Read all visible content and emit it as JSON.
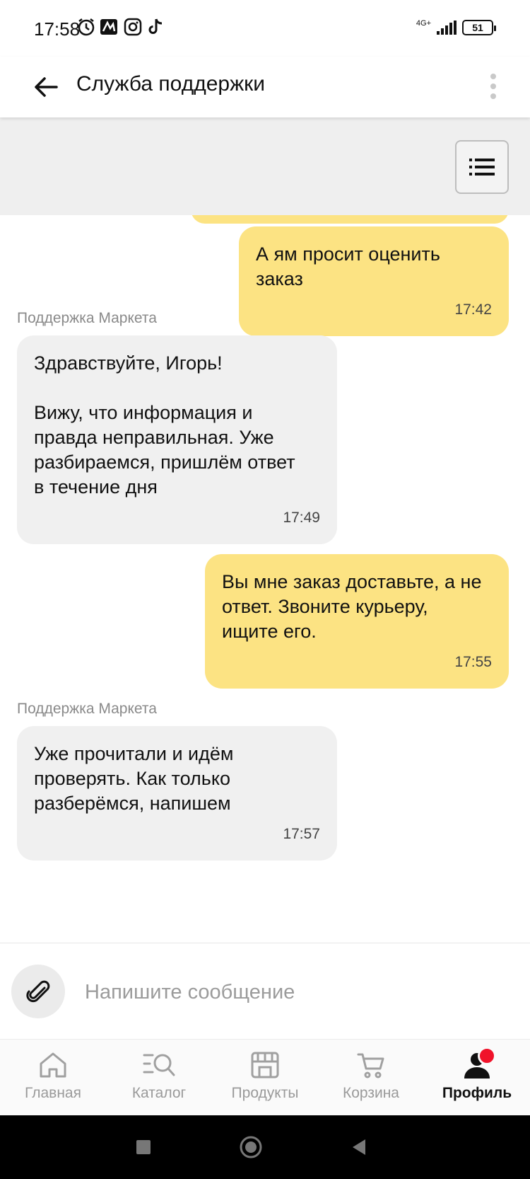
{
  "status_bar": {
    "time": "17:58",
    "icons": [
      "alarm-icon",
      "app-notification-icon",
      "instagram-icon",
      "tiktok-icon"
    ],
    "network": "4G+",
    "battery": "51"
  },
  "header": {
    "title": "Служба поддержки"
  },
  "messages": [
    {
      "sender_type": "user",
      "text": "А ям просит оценить заказ",
      "time": "17:42"
    },
    {
      "sender_type": "support",
      "sender": "Поддержка Маркета",
      "text": "Здравствуйте, Игорь!\n\nВижу, что информация и\nправда неправильная. Уже\nразбираемся, пришлём ответ\nв течение дня",
      "time": "17:49"
    },
    {
      "sender_type": "user",
      "text": "Вы мне заказ доставьте, а не\nответ. Звоните курьеру,\nищите его.",
      "time": "17:55"
    },
    {
      "sender_type": "support",
      "sender": "Поддержка Маркета",
      "text": "Уже прочитали и идём\nпроверять. Как только\nразберёмся, напишем",
      "time": "17:57"
    }
  ],
  "input": {
    "placeholder": "Напишите сообщение",
    "value": ""
  },
  "bottom_nav": {
    "items": [
      {
        "label": "Главная",
        "icon": "home-icon",
        "active": false
      },
      {
        "label": "Каталог",
        "icon": "catalog-search-icon",
        "active": false
      },
      {
        "label": "Продукты",
        "icon": "store-icon",
        "active": false
      },
      {
        "label": "Корзина",
        "icon": "cart-icon",
        "active": false
      },
      {
        "label": "Профиль",
        "icon": "profile-icon",
        "active": true,
        "notification": true
      }
    ]
  },
  "colors": {
    "user_bubble": "#fce383",
    "support_bubble": "#f0f0f0",
    "notification_dot": "#f0132a"
  }
}
